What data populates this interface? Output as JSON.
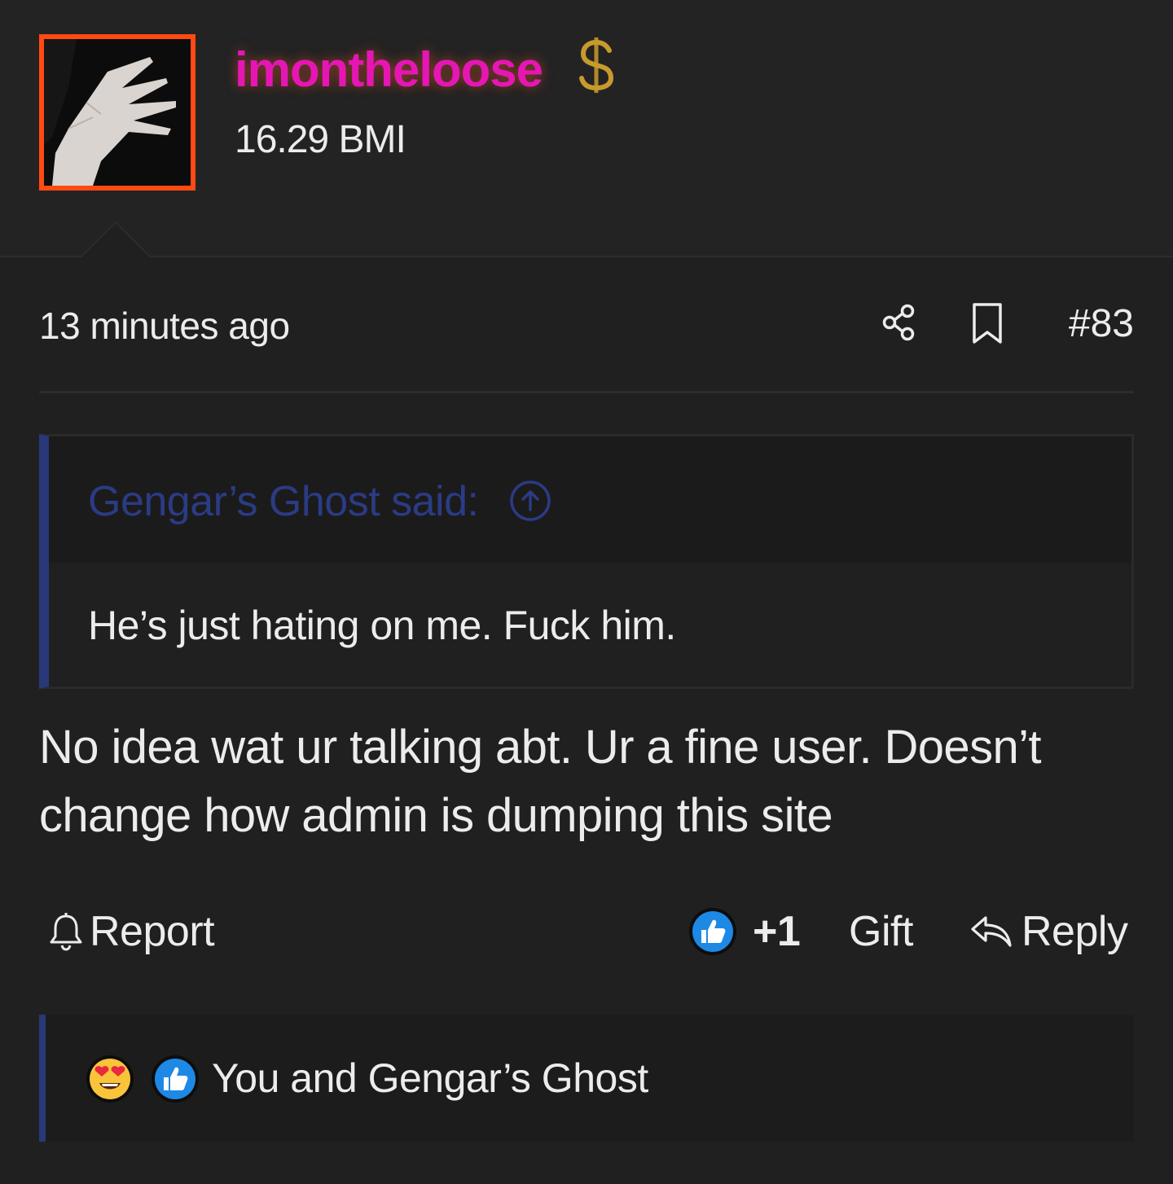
{
  "user": {
    "username": "imontheloose",
    "stat": "16.29 BMI",
    "badge_icon": "dollar-sign-icon",
    "avatar_border_color": "#ff4a12",
    "username_color": "#e616b4"
  },
  "post": {
    "time": "13 minutes ago",
    "number": "#83",
    "share_icon": "share-icon",
    "bookmark_icon": "bookmark-icon"
  },
  "quote": {
    "author": "Gengar’s Ghost said:",
    "text": "He’s just hating on me. Fuck him.",
    "accent_color": "#293878"
  },
  "body": "No idea wat ur talking abt. Ur a fine user. Doesn’t change how admin is dumping this site",
  "actions": {
    "report_label": "Report",
    "like_count": "+1",
    "gift_label": "Gift",
    "reply_label": "Reply"
  },
  "reactions": {
    "emojis": [
      "heart-eyes-icon",
      "thumbs-up-icon"
    ],
    "text": "You and Gengar’s Ghost"
  }
}
